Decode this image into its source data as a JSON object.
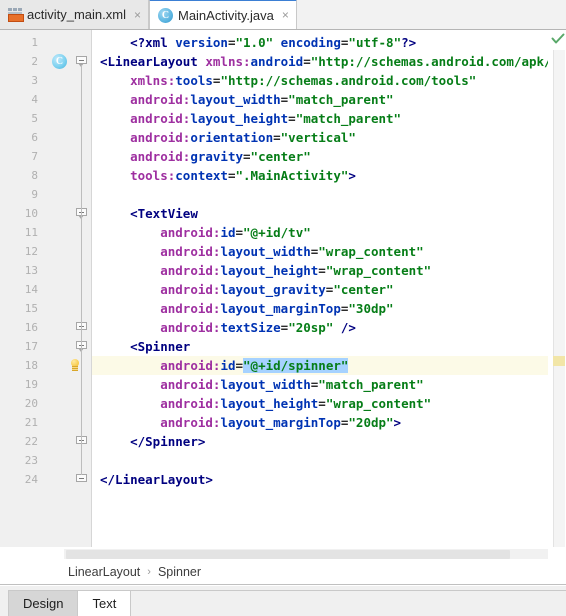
{
  "editor_tabs": [
    {
      "label": "activity_main.xml",
      "icon": "xml-layout-icon",
      "active": false,
      "close": "×"
    },
    {
      "label": "MainActivity.java",
      "icon": "java-class-icon",
      "active": true,
      "close": "×"
    }
  ],
  "gutter": {
    "line_numbers": [
      "1",
      "2",
      "3",
      "4",
      "5",
      "6",
      "7",
      "8",
      "9",
      "10",
      "11",
      "12",
      "13",
      "14",
      "15",
      "16",
      "17",
      "18",
      "19",
      "20",
      "21",
      "22",
      "23",
      "24"
    ],
    "class_marker_line": 2,
    "class_marker_glyph": "C",
    "bulb_line": 18
  },
  "code_lines": [
    {
      "n": 1,
      "current": false,
      "tokens": [
        {
          "t": "    ",
          "c": "punc"
        },
        {
          "t": "<?xml",
          "c": "pi"
        },
        {
          "t": " ",
          "c": "punc"
        },
        {
          "t": "version",
          "c": "attr"
        },
        {
          "t": "=",
          "c": "punc"
        },
        {
          "t": "\"1.0\"",
          "c": "val"
        },
        {
          "t": " ",
          "c": "punc"
        },
        {
          "t": "encoding",
          "c": "attr"
        },
        {
          "t": "=",
          "c": "punc"
        },
        {
          "t": "\"utf-8\"",
          "c": "val"
        },
        {
          "t": "?>",
          "c": "pi"
        }
      ]
    },
    {
      "n": 2,
      "current": false,
      "tokens": [
        {
          "t": "<LinearLayout",
          "c": "tag"
        },
        {
          "t": " ",
          "c": "punc"
        },
        {
          "t": "xmlns:",
          "c": "ns"
        },
        {
          "t": "android",
          "c": "attr"
        },
        {
          "t": "=",
          "c": "punc"
        },
        {
          "t": "\"http://schemas.android.com/apk/res/android\"",
          "c": "val"
        }
      ]
    },
    {
      "n": 3,
      "current": false,
      "tokens": [
        {
          "t": "    ",
          "c": "punc"
        },
        {
          "t": "xmlns:",
          "c": "ns"
        },
        {
          "t": "tools",
          "c": "attr"
        },
        {
          "t": "=",
          "c": "punc"
        },
        {
          "t": "\"http://schemas.android.com/tools\"",
          "c": "val"
        }
      ]
    },
    {
      "n": 4,
      "current": false,
      "tokens": [
        {
          "t": "    ",
          "c": "punc"
        },
        {
          "t": "android:",
          "c": "ns"
        },
        {
          "t": "layout_width",
          "c": "attr"
        },
        {
          "t": "=",
          "c": "punc"
        },
        {
          "t": "\"match_parent\"",
          "c": "val"
        }
      ]
    },
    {
      "n": 5,
      "current": false,
      "tokens": [
        {
          "t": "    ",
          "c": "punc"
        },
        {
          "t": "android:",
          "c": "ns"
        },
        {
          "t": "layout_height",
          "c": "attr"
        },
        {
          "t": "=",
          "c": "punc"
        },
        {
          "t": "\"match_parent\"",
          "c": "val"
        }
      ]
    },
    {
      "n": 6,
      "current": false,
      "tokens": [
        {
          "t": "    ",
          "c": "punc"
        },
        {
          "t": "android:",
          "c": "ns"
        },
        {
          "t": "orientation",
          "c": "attr"
        },
        {
          "t": "=",
          "c": "punc"
        },
        {
          "t": "\"vertical\"",
          "c": "val"
        }
      ]
    },
    {
      "n": 7,
      "current": false,
      "tokens": [
        {
          "t": "    ",
          "c": "punc"
        },
        {
          "t": "android:",
          "c": "ns"
        },
        {
          "t": "gravity",
          "c": "attr"
        },
        {
          "t": "=",
          "c": "punc"
        },
        {
          "t": "\"center\"",
          "c": "val"
        }
      ]
    },
    {
      "n": 8,
      "current": false,
      "tokens": [
        {
          "t": "    ",
          "c": "punc"
        },
        {
          "t": "tools:",
          "c": "ns"
        },
        {
          "t": "context",
          "c": "attr"
        },
        {
          "t": "=",
          "c": "punc"
        },
        {
          "t": "\".MainActivity\"",
          "c": "val"
        },
        {
          "t": ">",
          "c": "tag"
        }
      ]
    },
    {
      "n": 9,
      "current": false,
      "tokens": [
        {
          "t": "",
          "c": "punc"
        }
      ]
    },
    {
      "n": 10,
      "current": false,
      "tokens": [
        {
          "t": "    ",
          "c": "punc"
        },
        {
          "t": "<TextView",
          "c": "tag"
        }
      ]
    },
    {
      "n": 11,
      "current": false,
      "tokens": [
        {
          "t": "        ",
          "c": "punc"
        },
        {
          "t": "android:",
          "c": "ns"
        },
        {
          "t": "id",
          "c": "attr"
        },
        {
          "t": "=",
          "c": "punc"
        },
        {
          "t": "\"@+id/tv\"",
          "c": "val"
        }
      ]
    },
    {
      "n": 12,
      "current": false,
      "tokens": [
        {
          "t": "        ",
          "c": "punc"
        },
        {
          "t": "android:",
          "c": "ns"
        },
        {
          "t": "layout_width",
          "c": "attr"
        },
        {
          "t": "=",
          "c": "punc"
        },
        {
          "t": "\"wrap_content\"",
          "c": "val"
        }
      ]
    },
    {
      "n": 13,
      "current": false,
      "tokens": [
        {
          "t": "        ",
          "c": "punc"
        },
        {
          "t": "android:",
          "c": "ns"
        },
        {
          "t": "layout_height",
          "c": "attr"
        },
        {
          "t": "=",
          "c": "punc"
        },
        {
          "t": "\"wrap_content\"",
          "c": "val"
        }
      ]
    },
    {
      "n": 14,
      "current": false,
      "tokens": [
        {
          "t": "        ",
          "c": "punc"
        },
        {
          "t": "android:",
          "c": "ns"
        },
        {
          "t": "layout_gravity",
          "c": "attr"
        },
        {
          "t": "=",
          "c": "punc"
        },
        {
          "t": "\"center\"",
          "c": "val"
        }
      ]
    },
    {
      "n": 15,
      "current": false,
      "tokens": [
        {
          "t": "        ",
          "c": "punc"
        },
        {
          "t": "android:",
          "c": "ns"
        },
        {
          "t": "layout_marginTop",
          "c": "attr"
        },
        {
          "t": "=",
          "c": "punc"
        },
        {
          "t": "\"30dp\"",
          "c": "val"
        }
      ]
    },
    {
      "n": 16,
      "current": false,
      "tokens": [
        {
          "t": "        ",
          "c": "punc"
        },
        {
          "t": "android:",
          "c": "ns"
        },
        {
          "t": "textSize",
          "c": "attr"
        },
        {
          "t": "=",
          "c": "punc"
        },
        {
          "t": "\"20sp\"",
          "c": "val"
        },
        {
          "t": " />",
          "c": "tag"
        }
      ]
    },
    {
      "n": 17,
      "current": false,
      "tokens": [
        {
          "t": "    ",
          "c": "punc"
        },
        {
          "t": "<Spinner",
          "c": "tag"
        }
      ]
    },
    {
      "n": 18,
      "current": true,
      "tokens": [
        {
          "t": "        ",
          "c": "punc"
        },
        {
          "t": "android:",
          "c": "ns"
        },
        {
          "t": "id",
          "c": "attr"
        },
        {
          "t": "=",
          "c": "punc"
        },
        {
          "t": "\"@+id/spinner\"",
          "c": "val",
          "sel": true
        }
      ]
    },
    {
      "n": 19,
      "current": false,
      "tokens": [
        {
          "t": "        ",
          "c": "punc"
        },
        {
          "t": "android:",
          "c": "ns"
        },
        {
          "t": "layout_width",
          "c": "attr"
        },
        {
          "t": "=",
          "c": "punc"
        },
        {
          "t": "\"match_parent\"",
          "c": "val"
        }
      ]
    },
    {
      "n": 20,
      "current": false,
      "tokens": [
        {
          "t": "        ",
          "c": "punc"
        },
        {
          "t": "android:",
          "c": "ns"
        },
        {
          "t": "layout_height",
          "c": "attr"
        },
        {
          "t": "=",
          "c": "punc"
        },
        {
          "t": "\"wrap_content\"",
          "c": "val"
        }
      ]
    },
    {
      "n": 21,
      "current": false,
      "tokens": [
        {
          "t": "        ",
          "c": "punc"
        },
        {
          "t": "android:",
          "c": "ns"
        },
        {
          "t": "layout_marginTop",
          "c": "attr"
        },
        {
          "t": "=",
          "c": "punc"
        },
        {
          "t": "\"20dp\"",
          "c": "val"
        },
        {
          "t": ">",
          "c": "tag"
        }
      ]
    },
    {
      "n": 22,
      "current": false,
      "tokens": [
        {
          "t": "    ",
          "c": "punc"
        },
        {
          "t": "</Spinner>",
          "c": "tag"
        }
      ]
    },
    {
      "n": 23,
      "current": false,
      "tokens": [
        {
          "t": "",
          "c": "punc"
        }
      ]
    },
    {
      "n": 24,
      "current": false,
      "tokens": [
        {
          "t": "</LinearLayout>",
          "c": "tag"
        }
      ]
    }
  ],
  "inspection": {
    "status_icon": "checkmark-icon",
    "status_color": "#59a869",
    "marker_color": "#f2e6a8"
  },
  "breadcrumb": {
    "items": [
      "LinearLayout",
      "Spinner"
    ],
    "separator": "›"
  },
  "bottom_tabs": [
    {
      "label": "Design",
      "active": false
    },
    {
      "label": "Text",
      "active": true
    }
  ]
}
